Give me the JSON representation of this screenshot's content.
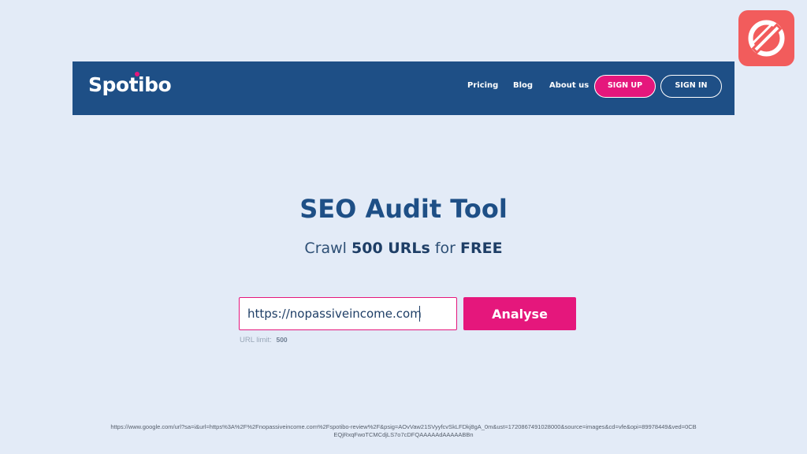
{
  "header": {
    "brand": "Spotibo",
    "nav": {
      "pricing": "Pricing",
      "blog": "Blog",
      "about": "About us"
    },
    "signup_label": "SIGN UP",
    "signin_label": "SIGN IN"
  },
  "hero": {
    "title": "SEO Audit Tool",
    "subtitle_prefix": "Crawl",
    "subtitle_count": "500 URLs",
    "subtitle_mid": "for",
    "subtitle_free": "FREE"
  },
  "form": {
    "url_value": "https://nopassiveincome.com",
    "analyse_label": "Analyse",
    "limit_label": "URL limit:",
    "limit_value": "500"
  },
  "source_url": "https://www.google.com/url?sa=i&url=https%3A%2F%2Fnopassiveincome.com%2Fspotibo-review%2F&psig=AOvVaw21SVyyfcvSkLFDkj8gA_0m&ust=1720867491028000&source=images&cd=vfe&opi=89978449&ved=0CBEQjRxqFwoTCMCdjLS7o7cDFQAAAAAdAAAAABBn",
  "colors": {
    "page_bg": "#e3ebf7",
    "header_bg": "#1e4f86",
    "accent": "#e5177c",
    "corner_logo_bg": "#f25c5c"
  },
  "icons": {
    "corner_logo": "brand-e-logo-icon"
  }
}
